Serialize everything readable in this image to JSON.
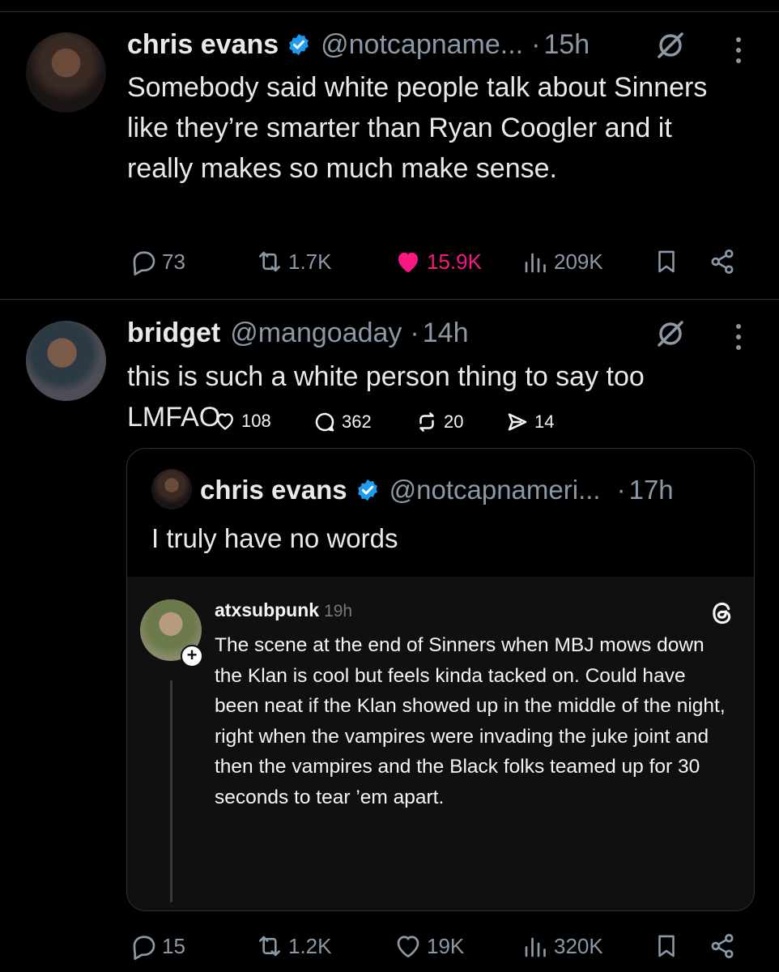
{
  "tweets": [
    {
      "name": "chris evans",
      "handle": "@notcapname...",
      "dot": "·",
      "time": "15h",
      "text": "Somebody said white people talk about Sinners like they’re smarter than Ryan Coogler and it really makes so much make sense.",
      "stats": {
        "replies": "73",
        "reposts": "1.7K",
        "likes": "15.9K",
        "views": "209K"
      },
      "liked": true
    },
    {
      "name": "bridget",
      "handle": "@mangoaday",
      "dot": "·",
      "time": "14h",
      "text": "this is such a white person thing to say too LMFAO",
      "stats": {
        "replies": "15",
        "reposts": "1.2K",
        "likes": "19K",
        "views": "320K"
      },
      "liked": false
    }
  ],
  "quote": {
    "name": "chris evans",
    "handle": "@notcapnameri...",
    "dot": "·",
    "time": "17h",
    "text": "I truly have no words"
  },
  "threads_post": {
    "user": "atxsubpunk",
    "time": "19h",
    "plus": "+",
    "text": "The scene at the end of Sinners when MBJ mows down the Klan is cool but feels kinda tacked on. Could have been neat if the Klan showed up in the middle of the night, right when the vampires were invading the juke joint and then the vampires and the Black folks teamed up for 30 seconds to tear ’em apart.",
    "stats": {
      "likes": "108",
      "replies": "362",
      "reposts": "20",
      "shares": "14"
    }
  },
  "colors": {
    "background": "#000000",
    "text": "#e7e9ea",
    "muted": "#8b98a5",
    "like": "#f91880",
    "verified": "#1d9bf0",
    "threads_bg": "#101010"
  }
}
